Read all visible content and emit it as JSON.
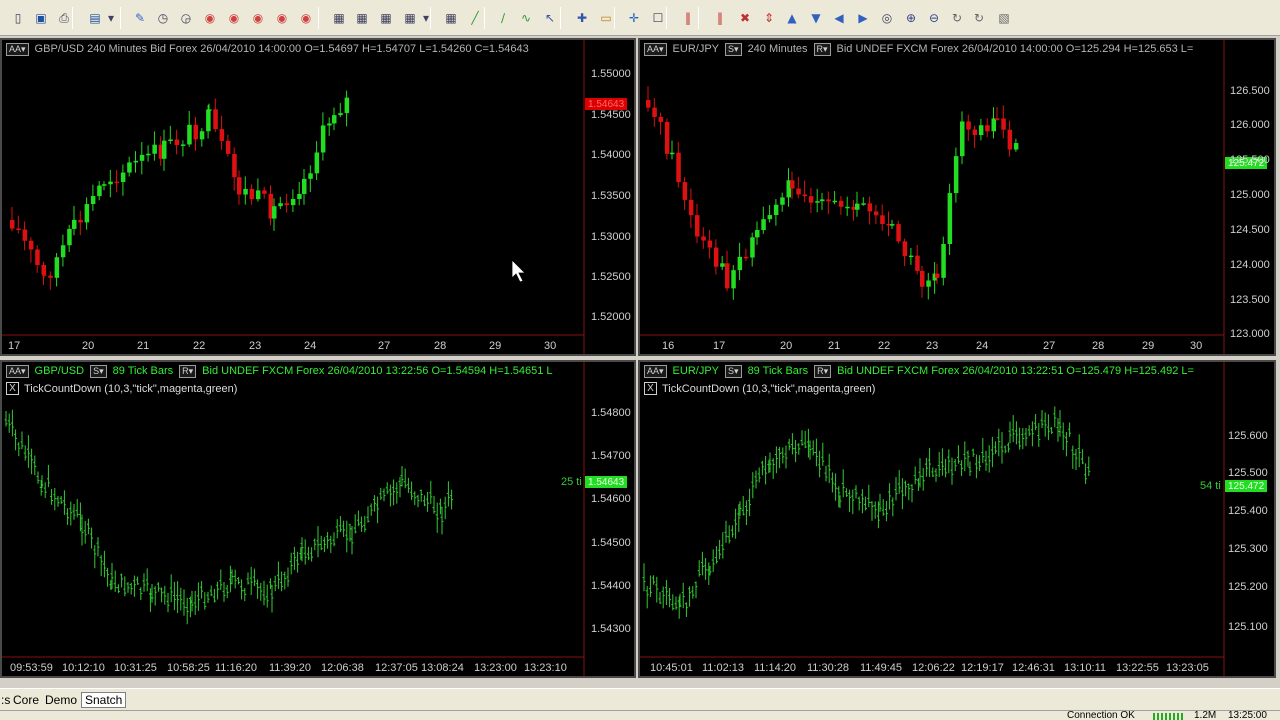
{
  "toolbar": {
    "icons": [
      "new-icon",
      "save-icon",
      "print-icon",
      "chart-icon",
      "dropdown-icon",
      "pencil-icon",
      "clock-240-icon",
      "clock-min-icon",
      "target-icon",
      "target-icon",
      "target-icon",
      "target-icon",
      "target-icon",
      "layout-icon",
      "layout-icon",
      "layout-icon",
      "layout-icon",
      "dropdown-icon",
      "grid-icon",
      "trendline-icon",
      "pen-icon",
      "zigzag-icon",
      "cursor-icon",
      "crosshair-icon",
      "comment-icon",
      "plus-icon",
      "frame-icon",
      "bars-icon",
      "bars-icon",
      "x-icon",
      "updown-icon",
      "arrow-up-icon",
      "arrow-down-icon",
      "arrow-left-icon",
      "arrow-right-icon",
      "coin-icon",
      "zoom-in-icon",
      "zoom-out-icon",
      "refresh-icon",
      "refresh-icon",
      "eraser-icon"
    ]
  },
  "colors": {
    "bull": "#22dd22",
    "bear": "#dd1111",
    "tick_line": "#33cc33",
    "header_grey": "#b4b4b4",
    "header_green": "#33ee33",
    "price_tag_red": "#dd0000",
    "price_tag_green": "#22dd22"
  },
  "panels": {
    "tl": {
      "aa": "AA",
      "header": "GBP/USD  240 Minutes  Bid  Forex   26/04/2010  14:00:00   O=1.54697   H=1.54707   L=1.54260   C=1.54643",
      "price_tag": "1.54643",
      "y_labels": [
        "1.55000",
        "1.54500",
        "1.54000",
        "1.53500",
        "1.53000",
        "1.52500",
        "1.52000"
      ],
      "x_labels": [
        "17",
        "20",
        "21",
        "22",
        "23",
        "24",
        "27",
        "28",
        "29",
        "30"
      ]
    },
    "tr": {
      "aa": "AA",
      "s": "S",
      "r": "R",
      "header_pre": "EUR/JPY",
      "header_mid": "240 Minutes",
      "header_post": "Bid  UNDEF  FXCM  Forex   26/04/2010  14:00:00   O=125.294   H=125.653   L=",
      "price_tag": "125.472",
      "y_labels": [
        "126.500",
        "126.000",
        "125.500",
        "125.000",
        "124.500",
        "124.000",
        "123.500",
        "123.000"
      ],
      "x_labels": [
        "16",
        "17",
        "20",
        "21",
        "22",
        "23",
        "24",
        "27",
        "28",
        "29",
        "30"
      ]
    },
    "bl": {
      "aa": "AA",
      "s": "S",
      "r": "R",
      "header_pre": "GBP/USD",
      "header_mid": "89 Tick Bars",
      "header_post": "Bid  UNDEF  FXCM  Forex   26/04/2010  13:22:56   O=1.54594   H=1.54651   L",
      "indicator_x": "X",
      "indicator": "TickCountDown  (10,3,\"tick\",magenta,green)",
      "tick_count": "25 ti",
      "price_tag": "1.54643",
      "y_labels": [
        "1.54800",
        "1.54700",
        "1.54600",
        "1.54500",
        "1.54400",
        "1.54300"
      ],
      "x_labels": [
        "09:53:59",
        "10:12:10",
        "10:31:25",
        "10:58:25",
        "11:16:20",
        "11:39:20",
        "12:06:38",
        "12:37:05",
        "13:08:24",
        "13:23:00",
        "13:23:10"
      ]
    },
    "br": {
      "aa": "AA",
      "s": "S",
      "r": "R",
      "header_pre": "EUR/JPY",
      "header_mid": "89 Tick Bars",
      "header_post": "Bid  UNDEF  FXCM  Forex   26/04/2010  13:22:51   O=125.479   H=125.492   L=",
      "indicator_x": "X",
      "indicator": "TickCountDown  (10,3,\"tick\",magenta,green)",
      "tick_count": "54 ti",
      "price_tag": "125.472",
      "y_labels": [
        "125.600",
        "125.500",
        "125.400",
        "125.300",
        "125.200",
        "125.100"
      ],
      "x_labels": [
        "10:45:01",
        "11:02:13",
        "11:14:20",
        "11:30:28",
        "11:49:45",
        "12:06:22",
        "12:19:17",
        "12:46:31",
        "13:10:11",
        "13:22:55",
        "13:23:05"
      ]
    }
  },
  "tabs": [
    ":s",
    "Core",
    "Demo",
    "Snatch"
  ],
  "status": {
    "connection": "Connection OK",
    "data_rate": "1.2M",
    "time": "13:25:00"
  }
}
